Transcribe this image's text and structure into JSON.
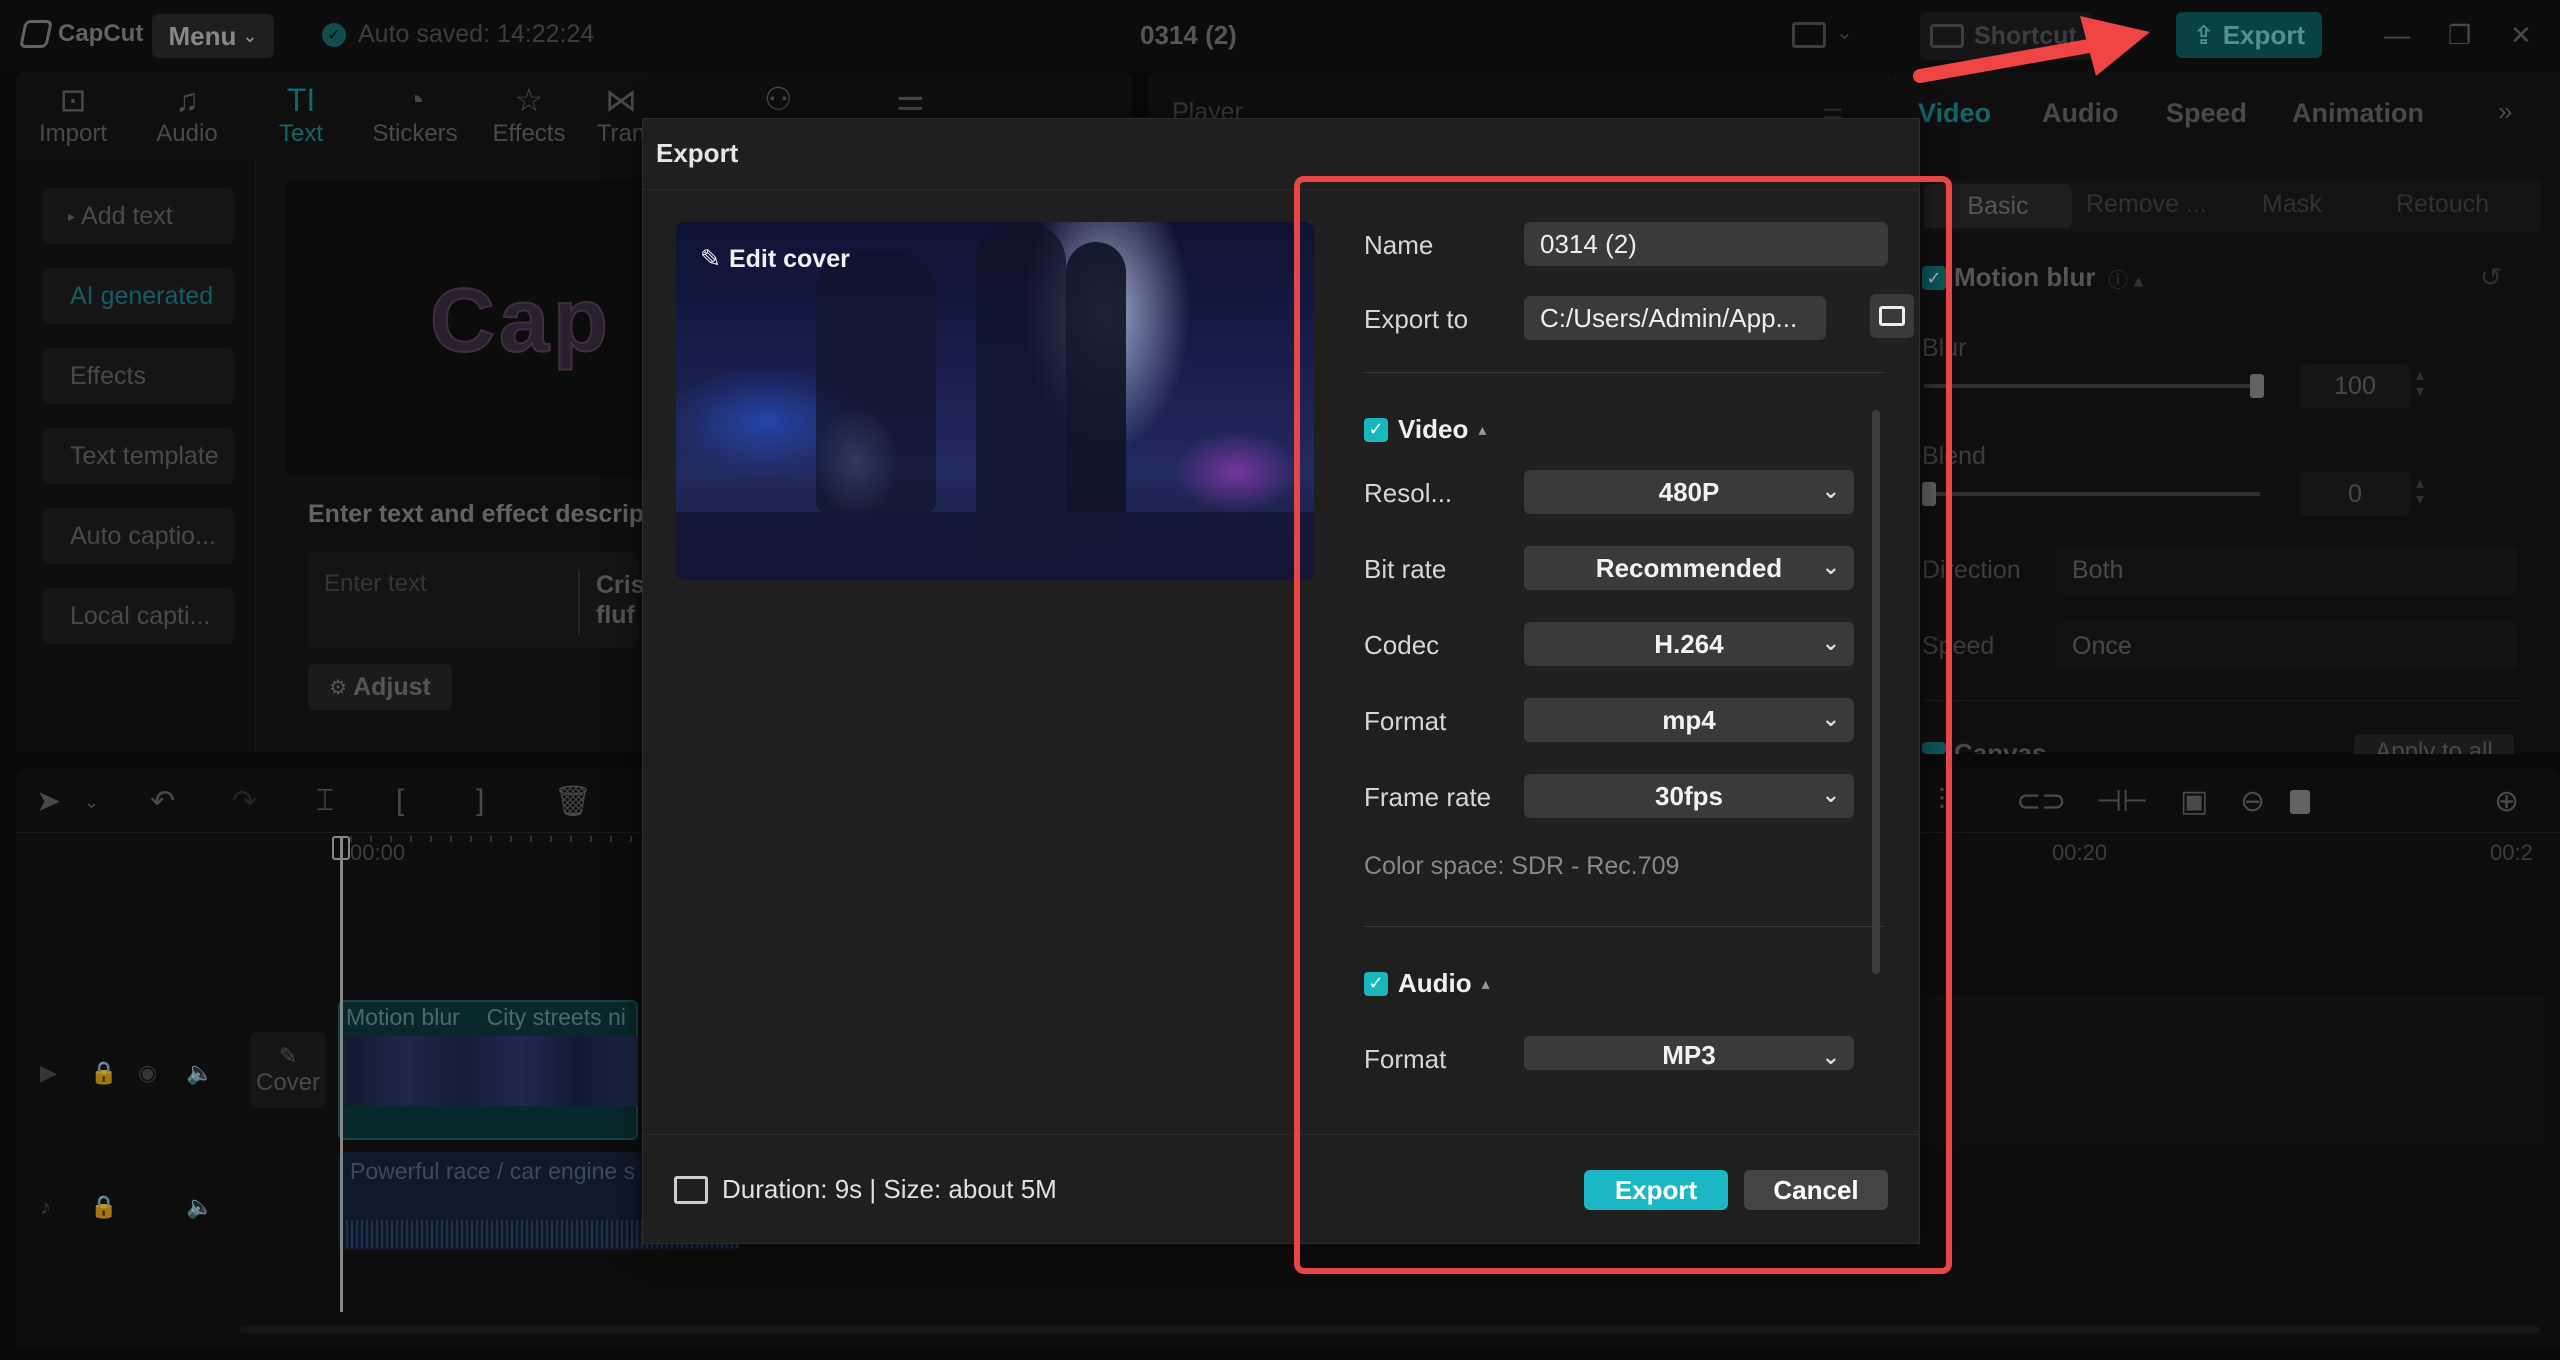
{
  "titlebar": {
    "app_name": "CapCut",
    "menu_label": "Menu",
    "autosave_text": "Auto saved: 14:22:24",
    "project_title": "0314 (2)",
    "shortcut_label": "Shortcut",
    "export_label": "Export"
  },
  "toolbar": {
    "items": [
      {
        "label": "Import",
        "icon": "import-icon"
      },
      {
        "label": "Audio",
        "icon": "audio-icon"
      },
      {
        "label": "Text",
        "icon": "text-icon"
      },
      {
        "label": "Stickers",
        "icon": "stickers-icon"
      },
      {
        "label": "Effects",
        "icon": "effects-icon"
      },
      {
        "label": "Tran",
        "icon": "transitions-icon"
      }
    ],
    "active": "Text"
  },
  "sidebar": {
    "items": [
      {
        "label": "Add text"
      },
      {
        "label": "AI generated"
      },
      {
        "label": "Effects"
      },
      {
        "label": "Text template"
      },
      {
        "label": "Auto captio..."
      },
      {
        "label": "Local capti..."
      }
    ],
    "active": "AI generated"
  },
  "text_panel": {
    "canvas_word": "Cap",
    "desc_title": "Enter text and effect descrip",
    "placeholder": "Enter text",
    "suggestion_line1": "Cris",
    "suggestion_line2": "fluf",
    "adjust_label": "Adjust"
  },
  "player": {
    "label": "Player"
  },
  "right_panel": {
    "tabs": [
      "Video",
      "Audio",
      "Speed",
      "Animation"
    ],
    "active_tab": "Video",
    "subtabs": [
      "Basic",
      "Remove ...",
      "Mask",
      "Retouch"
    ],
    "active_subtab": "Basic",
    "motion_blur_label": "Motion blur",
    "blur_label": "Blur",
    "blur_value": "100",
    "blur_level": 1.0,
    "blend_label": "Blend",
    "blend_value": "0",
    "blend_level": 0.0,
    "direction_label": "Direction",
    "direction_value": "Both",
    "speed_label": "Speed",
    "speed_value": "Once",
    "canvas_label": "Canvas",
    "apply_all_label": "Apply to all"
  },
  "timeline": {
    "ruler_start": "00:00",
    "ruler_marks": [
      "00:20",
      "00:2"
    ],
    "cover_label": "Cover",
    "video_clip_labels": [
      "Motion blur",
      "City streets ni"
    ],
    "audio_clip_label": "Powerful race / car engine s"
  },
  "export_dialog": {
    "title": "Export",
    "edit_cover_label": "Edit cover",
    "name_label": "Name",
    "name_value": "0314 (2)",
    "export_to_label": "Export to",
    "export_to_value": "C:/Users/Admin/App...",
    "video_section": {
      "title": "Video",
      "checked": true,
      "fields": [
        {
          "label": "Resol...",
          "value": "480P"
        },
        {
          "label": "Bit rate",
          "value": "Recommended"
        },
        {
          "label": "Codec",
          "value": "H.264"
        },
        {
          "label": "Format",
          "value": "mp4"
        },
        {
          "label": "Frame rate",
          "value": "30fps"
        }
      ],
      "color_space": "Color space: SDR - Rec.709"
    },
    "audio_section": {
      "title": "Audio",
      "checked": true,
      "format_label": "Format",
      "format_value": "MP3"
    },
    "duration_text": "Duration: 9s | Size: about 5M",
    "export_button": "Export",
    "cancel_button": "Cancel"
  },
  "colors": {
    "accent": "#1cb7c4",
    "highlight": "#e84646",
    "dialog_bg": "#1f1f1f"
  }
}
